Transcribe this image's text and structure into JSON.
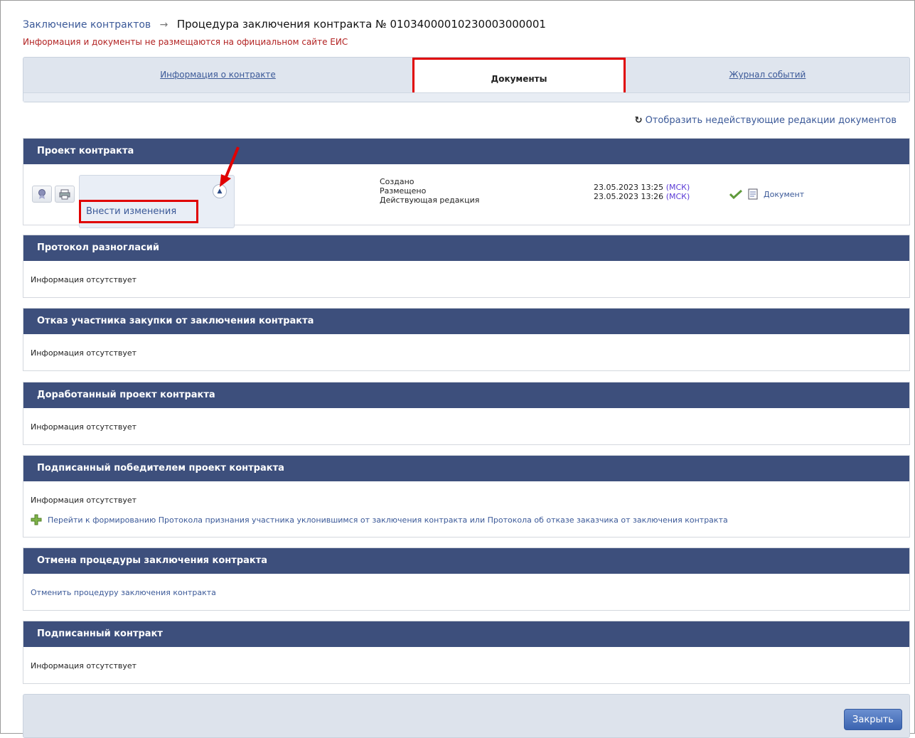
{
  "breadcrumb": {
    "parent": "Заключение контрактов",
    "separator": "→",
    "current": "Процедура заключения контракта № 01034000010230003000001"
  },
  "warning": "Информация и документы не размещаются на официальном сайте ЕИС",
  "tabs": [
    {
      "label": "Информация о контракте",
      "active": false
    },
    {
      "label": "Документы",
      "active": true
    },
    {
      "label": "Журнал событий",
      "active": false
    }
  ],
  "show_inactive": "Отобразить недействующие редакции документов",
  "sections": {
    "project": {
      "title": "Проект контракта",
      "popup_action": "Внести изменения",
      "statuses": [
        "Создано",
        "Размещено",
        "Действующая редакция"
      ],
      "dates": [
        {
          "value": "23.05.2023 13:25",
          "tz": "(МСК)"
        },
        {
          "value": "23.05.2023 13:26",
          "tz": "(МСК)"
        }
      ],
      "document_label": "Документ"
    },
    "disagreements": {
      "title": "Протокол разногласий",
      "empty": "Информация отсутствует"
    },
    "refusal": {
      "title": "Отказ участника закупки от заключения контракта",
      "empty": "Информация отсутствует"
    },
    "revised": {
      "title": "Доработанный проект контракта",
      "empty": "Информация отсутствует"
    },
    "signed_by_winner": {
      "title": "Подписанный победителем проект контракта",
      "empty": "Информация отсутствует",
      "action": "Перейти к формированию Протокола признания участника уклонившимся от заключения контракта или Протокола об отказе заказчика от заключения контракта"
    },
    "cancel": {
      "title": "Отмена процедуры заключения контракта",
      "action": "Отменить процедуру заключения контракта"
    },
    "signed": {
      "title": "Подписанный контракт",
      "empty": "Информация отсутствует"
    }
  },
  "footer": {
    "close_label": "Закрыть"
  },
  "colors": {
    "header": "#3d4f7c",
    "link": "#3b5998",
    "highlight": "#e00000"
  }
}
